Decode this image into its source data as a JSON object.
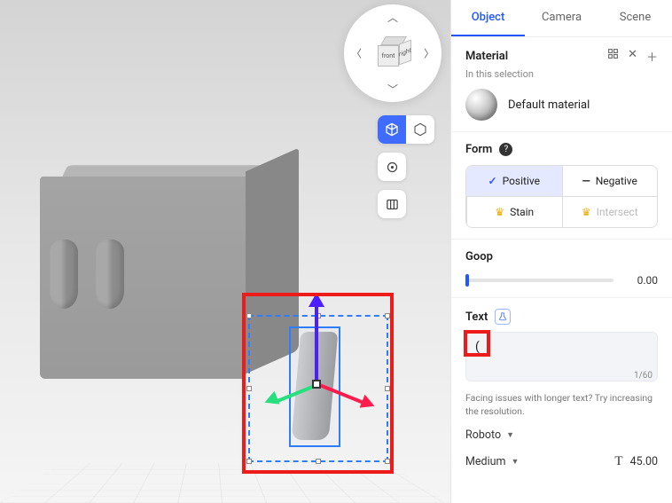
{
  "viewport": {
    "viewcube": {
      "front": "front",
      "right": "right"
    }
  },
  "panel": {
    "tabs": {
      "object": "Object",
      "camera": "Camera",
      "scene": "Scene"
    },
    "material": {
      "title": "Material",
      "subtitle": "In this selection",
      "default_name": "Default material"
    },
    "form": {
      "title": "Form",
      "positive": "Positive",
      "negative": "Negative",
      "stain": "Stain",
      "intersect": "Intersect"
    },
    "goop": {
      "title": "Goop",
      "value": "0.00"
    },
    "text": {
      "title": "Text",
      "value": "(",
      "count": "1/60",
      "hint": "Facing issues with longer text? Try increasing the resolution."
    },
    "font": {
      "family": "Roboto",
      "weight": "Medium",
      "size": "45.00"
    }
  }
}
